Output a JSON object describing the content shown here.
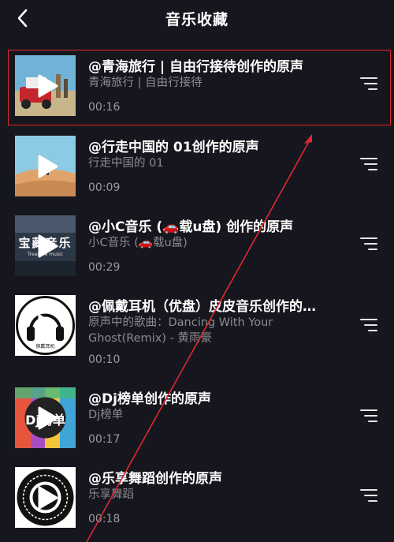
{
  "header": {
    "title": "音乐收藏",
    "back_icon": "chevron-left-icon"
  },
  "items": [
    {
      "name": "@青海旅行 | 自由行接待创作的原声",
      "subtitle": "青海旅行 | 自由行接待",
      "duration": "00:16"
    },
    {
      "name": "@行走中国的 01创作的原声",
      "subtitle": "行走中国的 01",
      "duration": "00:09"
    },
    {
      "name": "@小C音乐 (🚗载u盘) 创作的原声",
      "subtitle": "小C音乐 (🚗载u盘)",
      "duration": "00:29",
      "cover_text": "宝藏音乐",
      "cover_subtext": "Treasure music"
    },
    {
      "name": "@佩戴耳机（优盘）皮皮音乐创作的…",
      "subtitle": "原声中的歌曲：Dancing With Your Ghost(Remix) - 黄雨豪",
      "subtitle_line1": "原声中的歌曲：Dancing With Your",
      "subtitle_line2": "Ghost(Remix) - 黄雨豪",
      "duration": "00:10",
      "cover_text": "佩戴耳机"
    },
    {
      "name": "@Dj榜单创作的原声",
      "subtitle": "Dj榜单",
      "duration": "00:17",
      "cover_text": "Dj榜单"
    },
    {
      "name": "@乐享舞蹈创作的原声",
      "subtitle": "乐享舞蹈",
      "duration": "00:18"
    }
  ],
  "colors": {
    "background": "#16161e",
    "highlight": "#e0282e"
  }
}
